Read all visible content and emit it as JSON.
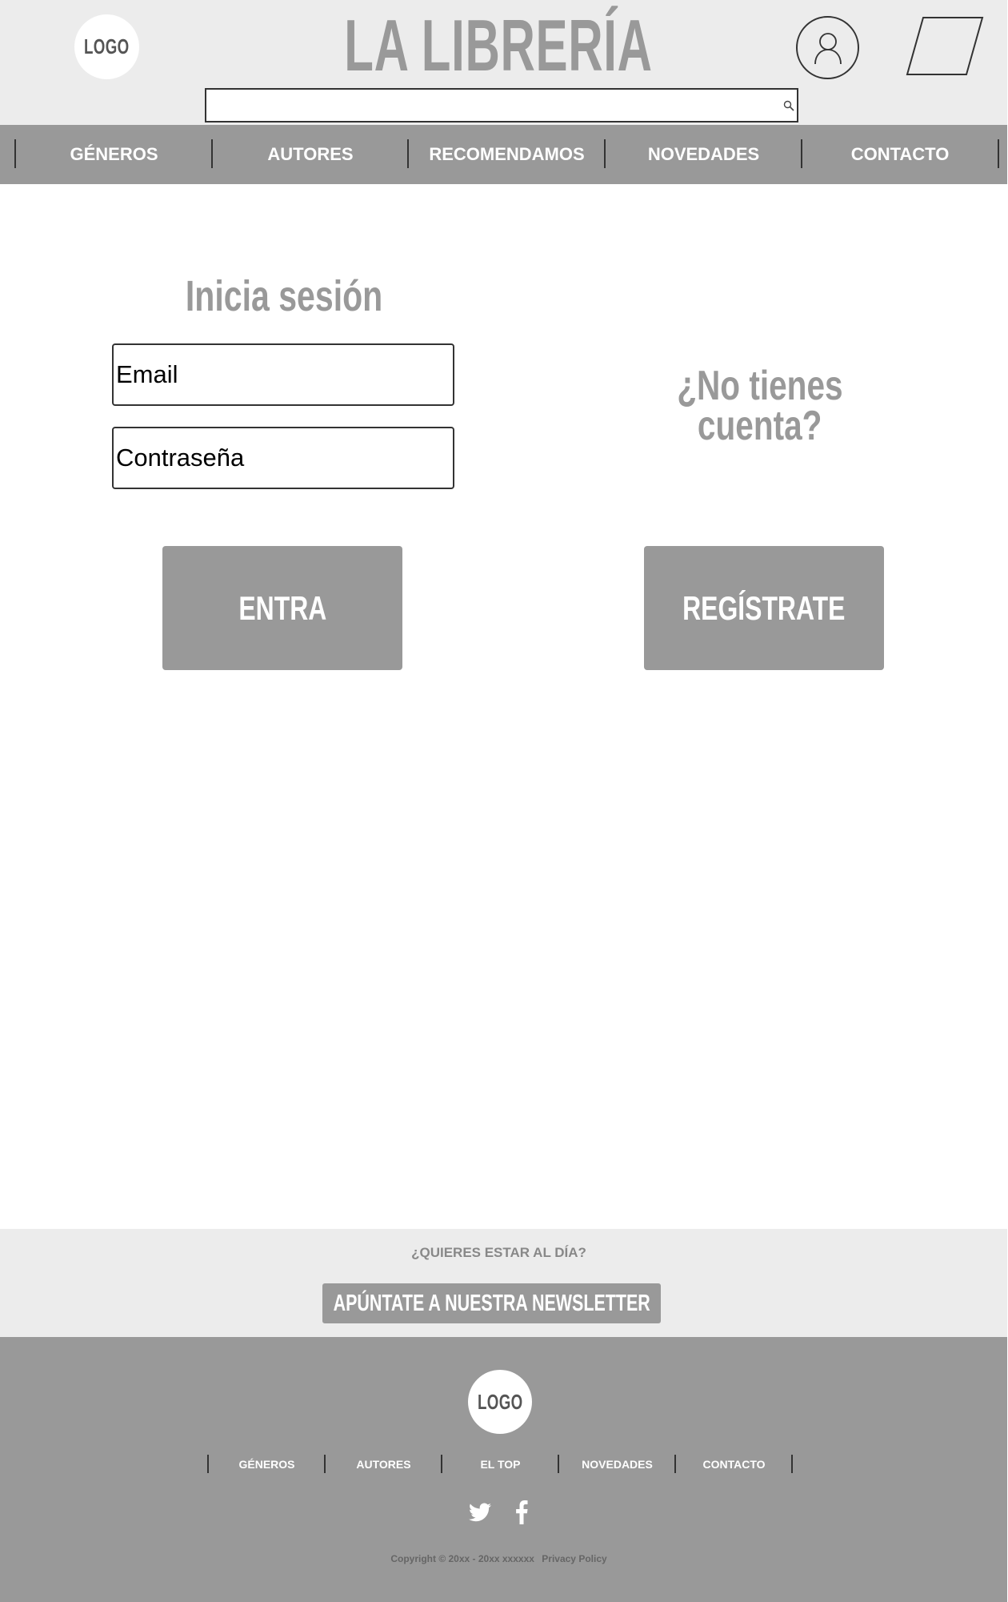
{
  "header": {
    "logo": "LOGO",
    "title": "LA LIBRERÍA",
    "search": {
      "value": "",
      "placeholder": ""
    }
  },
  "nav": {
    "items": [
      {
        "label": "GÉNEROS"
      },
      {
        "label": "AUTORES"
      },
      {
        "label": "RECOMENDAMOS"
      },
      {
        "label": "NOVEDADES"
      },
      {
        "label": "CONTACTO"
      }
    ]
  },
  "login": {
    "heading": "Inicia sesión",
    "email_placeholder": "Email",
    "password_placeholder": "Contraseña",
    "submit_label": "ENTRA"
  },
  "register": {
    "heading_line1": "¿No tienes",
    "heading_line2": "cuenta?",
    "button_label": "REGÍSTRATE"
  },
  "newsletter": {
    "question": "¿QUIERES ESTAR AL DÍA?",
    "button_label": "APÚNTATE A NUESTRA NEWSLETTER"
  },
  "footer": {
    "logo": "LOGO",
    "links": [
      {
        "label": "GÉNEROS"
      },
      {
        "label": "AUTORES"
      },
      {
        "label": "EL TOP"
      },
      {
        "label": "NOVEDADES"
      },
      {
        "label": "CONTACTO"
      }
    ],
    "social": [
      "twitter-icon",
      "facebook-icon"
    ],
    "copyright": "Copyright © 20xx - 20xx xxxxxx",
    "privacy": "Privacy Policy"
  },
  "colors": {
    "header_bg": "#ececec",
    "nav_bg": "#999999",
    "accent_gray": "#999999",
    "footer_bg": "#999999",
    "border": "#333333"
  }
}
